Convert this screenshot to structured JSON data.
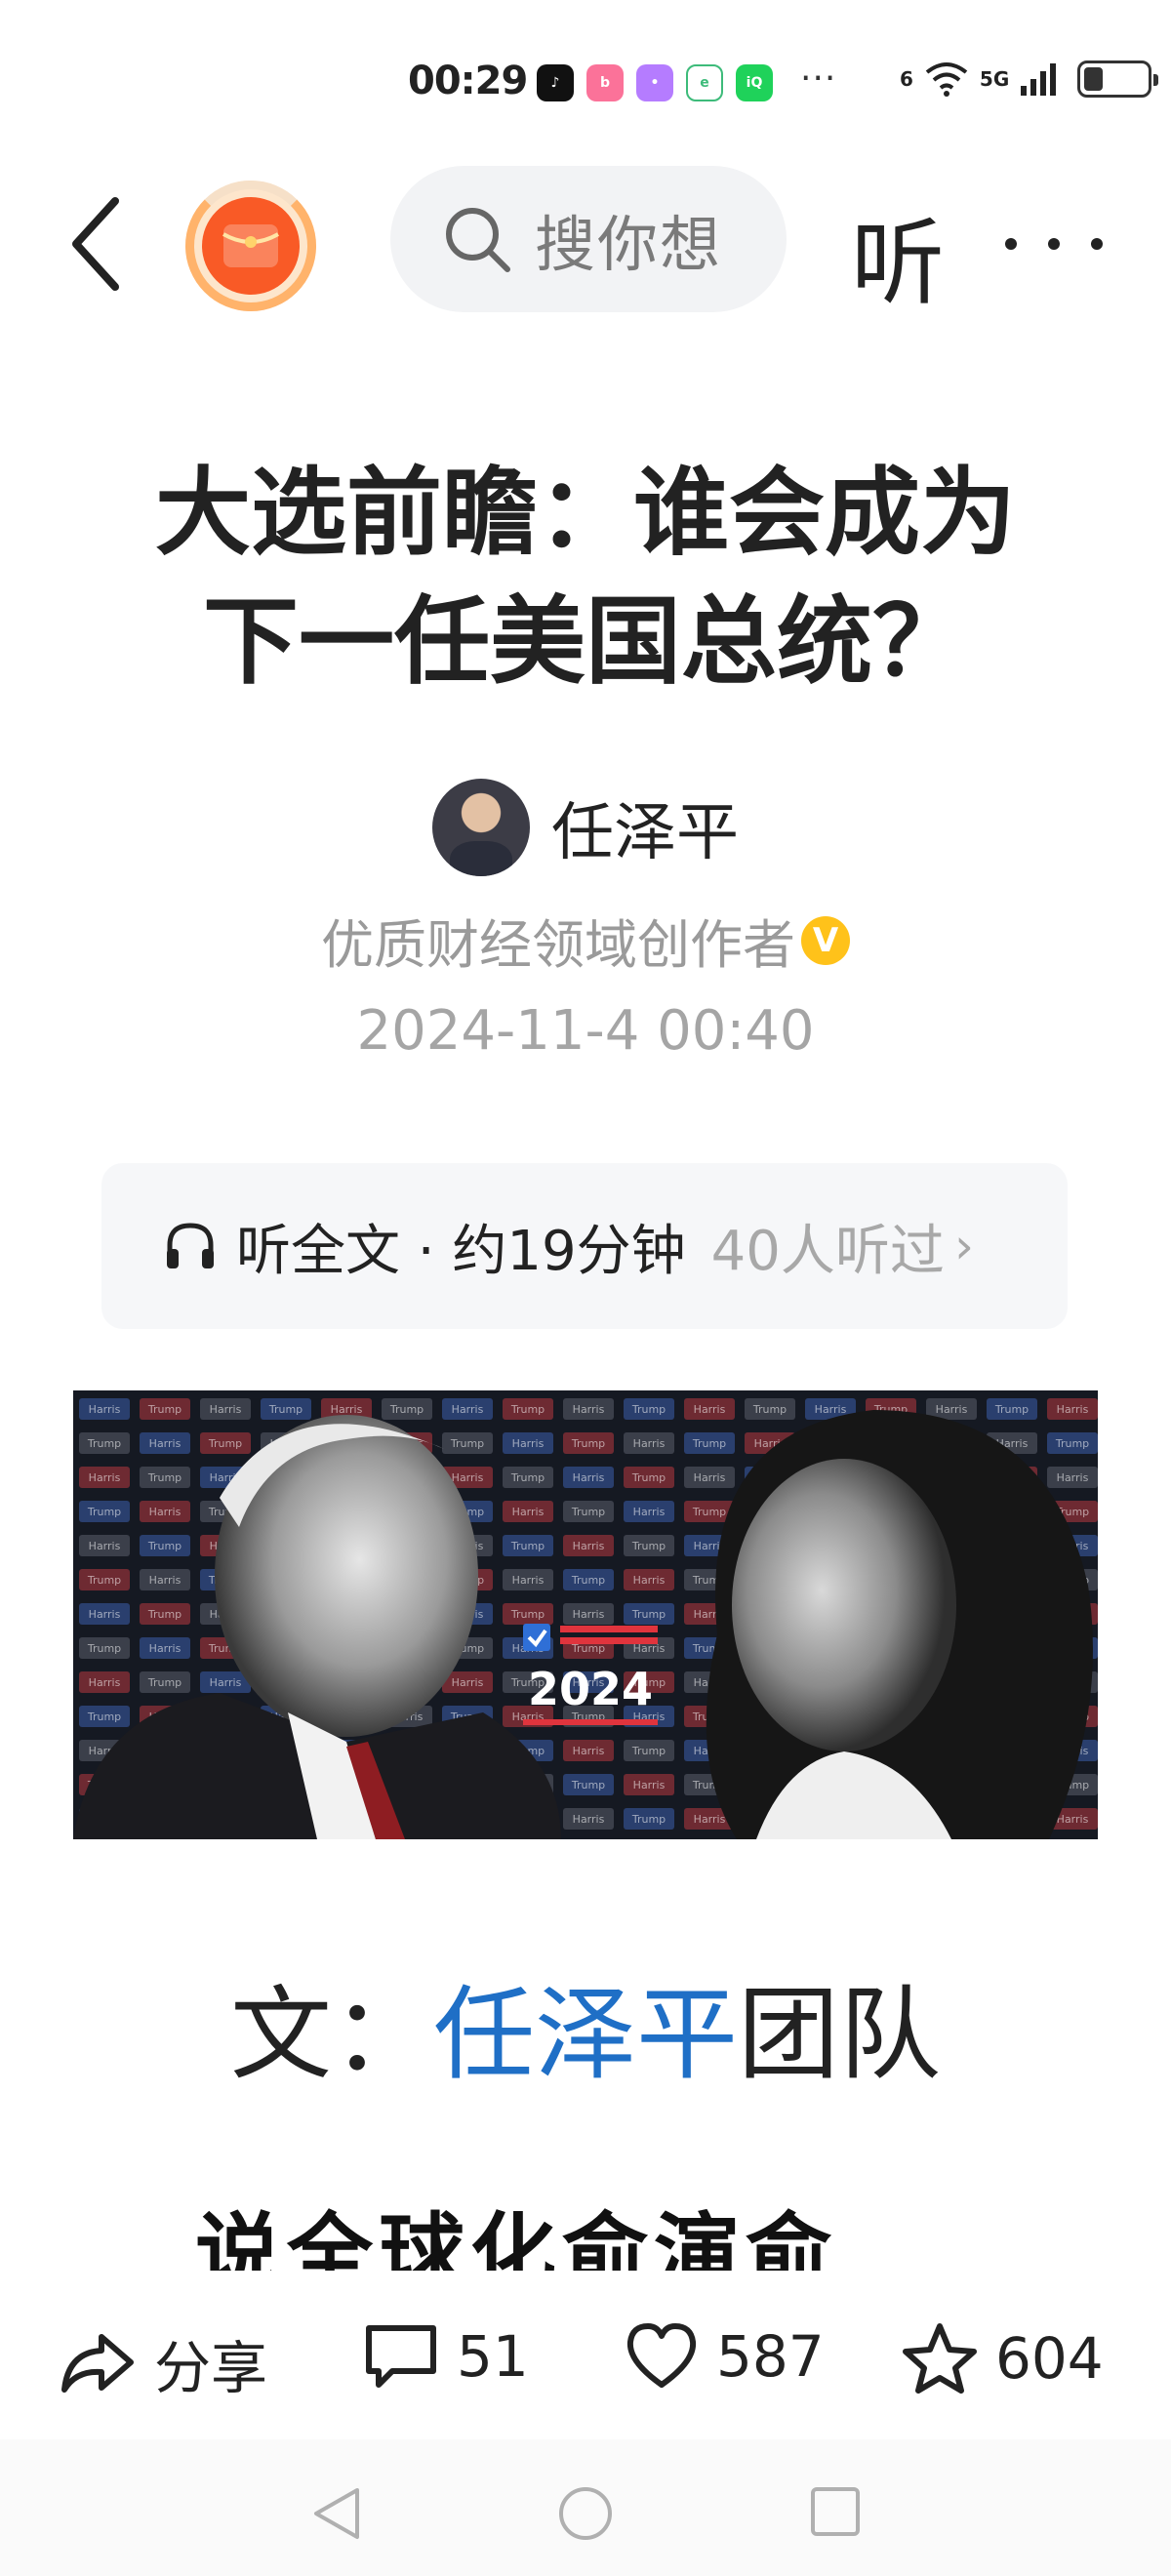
{
  "status_bar": {
    "time": "00:29",
    "network_a": "6",
    "network_b": "5G",
    "more": "···",
    "apps": [
      {
        "icon": "douyin-icon",
        "color": "#111111",
        "label": "♪"
      },
      {
        "icon": "bilibili-icon",
        "color": "#fb7299",
        "label": "b"
      },
      {
        "icon": "chat-app-icon",
        "color": "#b57cff",
        "label": "•"
      },
      {
        "icon": "green-app-icon",
        "color": "#ffffff",
        "label": "e"
      },
      {
        "icon": "iqiyi-icon",
        "color": "#1fd25a",
        "label": "iQ"
      }
    ],
    "battery_level": 0.3
  },
  "top_nav": {
    "search_placeholder": "搜你想",
    "listen_label": "听"
  },
  "article": {
    "title": "大选前瞻：谁会成为下一任美国总统？",
    "author_name": "任泽平",
    "author_desc": "优质财经领域创作者",
    "verified_mark": "V",
    "publish_time": "2024-11-4  00:40"
  },
  "listen": {
    "main": "听全文 · 约19分钟",
    "count": "40人听过",
    "chevron": "›"
  },
  "hero_image": {
    "year": "2024",
    "tag_a": "Harris",
    "tag_b": "Trump"
  },
  "body": {
    "byline_prefix": "文：",
    "byline_author": "任泽平",
    "byline_suffix": "团队",
    "partial_line": "说全球化俞演俞"
  },
  "actions": {
    "share_label": "分享",
    "comments": "51",
    "likes": "587",
    "favorites": "604"
  }
}
